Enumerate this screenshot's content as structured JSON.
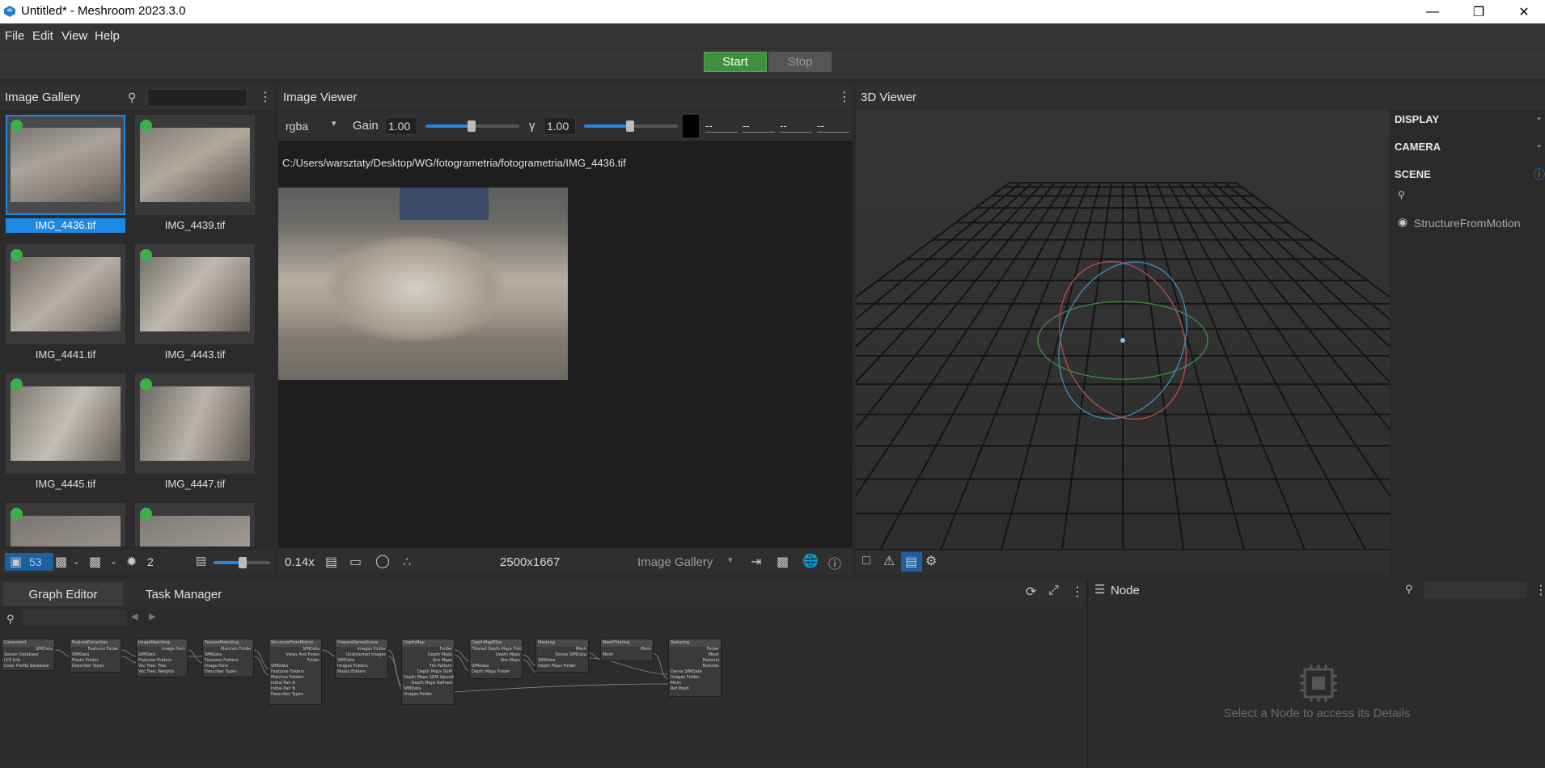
{
  "window": {
    "title": "Untitled* - Meshroom 2023.3.0"
  },
  "menu": [
    "File",
    "Edit",
    "View",
    "Help"
  ],
  "run": {
    "start": "Start",
    "stop": "Stop"
  },
  "gallery": {
    "title": "Image Gallery",
    "images": [
      "IMG_4436.tif",
      "IMG_4439.tif",
      "IMG_4441.tif",
      "IMG_4443.tif",
      "IMG_4445.tif",
      "IMG_4447.tif"
    ],
    "footer": {
      "images_count": "53",
      "cameras": "-",
      "no_cameras": "-",
      "intrinsics": "2"
    }
  },
  "viewer": {
    "title": "Image Viewer",
    "channel": "rgba",
    "gain_label": "Gain",
    "gain_value": "1.00",
    "gamma_label": "γ",
    "gamma_value": "1.00",
    "pixel_values": [
      "--",
      "--",
      "--",
      "--"
    ],
    "path": "C:/Users/warsztaty/Desktop/WG/fotogrametria/fotogrametria/IMG_4436.tif",
    "zoom": "0.14x",
    "resolution": "2500x1667",
    "source": "Image Gallery"
  },
  "viewer3d": {
    "title": "3D Viewer"
  },
  "scene_panel": {
    "display": "DISPLAY",
    "camera": "CAMERA",
    "scene": "SCENE",
    "item": "StructureFromMotion"
  },
  "graph": {
    "tab_editor": "Graph Editor",
    "tab_tasks": "Task Manager",
    "nodes": [
      {
        "title": "CameraInit",
        "lines": [
          "SfMData",
          "Sensor Database",
          "LCP Info",
          "Color Profile Database"
        ]
      },
      {
        "title": "FeatureExtraction",
        "lines": [
          "Features Folder",
          "SfMData",
          "Masks Folder",
          "Describer Types"
        ]
      },
      {
        "title": "ImageMatching",
        "lines": [
          "Image Pairs",
          "SfMData",
          "Features Folders",
          "Voc Tree: Tree",
          "Voc Tree: Weights"
        ]
      },
      {
        "title": "FeatureMatching",
        "lines": [
          "Matches Folder",
          "SfMData",
          "Features Folders",
          "Image Pairs",
          "Describer Types"
        ]
      },
      {
        "title": "StructureFromMotion",
        "lines": [
          "SfMData",
          "Views And Poses",
          "Folder",
          "SfMData",
          "Features Folders",
          "Matches Folders",
          "Initial Pair A",
          "Initial Pair B",
          "Describer Types"
        ]
      },
      {
        "title": "PrepareDenseScene",
        "lines": [
          "Images Folder",
          "Undistorted Images",
          "SfMData",
          "Images Folders",
          "Masks Folders"
        ]
      },
      {
        "title": "DepthMap",
        "lines": [
          "Folder",
          "Depth Maps",
          "Sim Maps",
          "Tile Pattern",
          "Depth Maps SGM",
          "Depth Maps SGM Upscaled",
          "Depth Maps Refined",
          "SfMData",
          "Images Folder"
        ]
      },
      {
        "title": "DepthMapFilter",
        "lines": [
          "Filtered Depth Maps Folder",
          "Depth Maps",
          "Sim Maps",
          "SfMData",
          "Depth Maps Folder"
        ]
      },
      {
        "title": "Meshing",
        "lines": [
          "Mesh",
          "Dense SfMData",
          "SfMData",
          "Depth Maps Folder"
        ]
      },
      {
        "title": "MeshFiltering",
        "lines": [
          "Mesh",
          "Mesh"
        ]
      },
      {
        "title": "Texturing",
        "lines": [
          "Folder",
          "Mesh",
          "Material",
          "Textures",
          "Dense SfMData",
          "Images Folder",
          "Mesh",
          "Ref Mesh"
        ]
      }
    ]
  },
  "node_panel": {
    "title": "Node",
    "empty_text": "Select a Node to access its Details"
  }
}
